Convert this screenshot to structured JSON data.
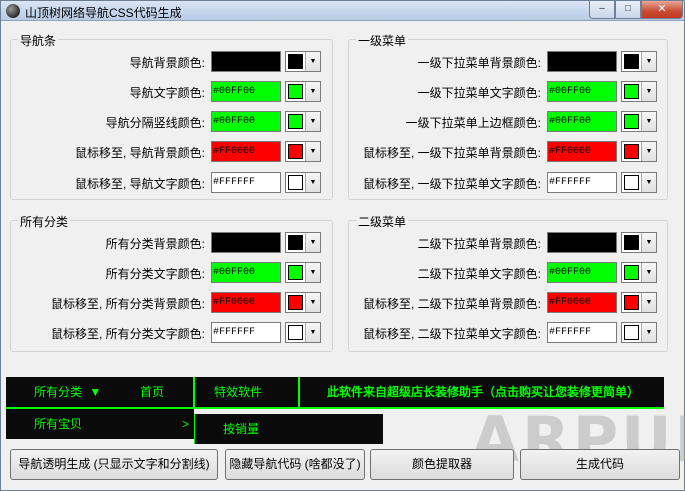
{
  "window": {
    "title": "山顶树网络导航CSS代码生成"
  },
  "groups": {
    "nav": {
      "title": "导航条",
      "rows": [
        {
          "label": "导航背景颜色:",
          "value": "",
          "color": "#000000"
        },
        {
          "label": "导航文字颜色:",
          "value": "#00FF00",
          "color": "#00FF00"
        },
        {
          "label": "导航分隔竖线颜色:",
          "value": "#00FF00",
          "color": "#00FF00"
        },
        {
          "label": "鼠标移至, 导航背景颜色:",
          "value": "#FF0000",
          "color": "#FF0000"
        },
        {
          "label": "鼠标移至, 导航文字颜色:",
          "value": "#FFFFFF",
          "color": "#FFFFFF"
        }
      ]
    },
    "menu1": {
      "title": "一级菜单",
      "rows": [
        {
          "label": "一级下拉菜单背景颜色:",
          "value": "",
          "color": "#000000"
        },
        {
          "label": "一级下拉菜单文字颜色:",
          "value": "#00FF00",
          "color": "#00FF00"
        },
        {
          "label": "一级下拉菜单上边框颜色:",
          "value": "#00FF00",
          "color": "#00FF00"
        },
        {
          "label": "鼠标移至, 一级下拉菜单背景颜色:",
          "value": "#FF0000",
          "color": "#FF0000"
        },
        {
          "label": "鼠标移至, 一级下拉菜单文字颜色:",
          "value": "#FFFFFF",
          "color": "#FFFFFF"
        }
      ]
    },
    "cat": {
      "title": "所有分类",
      "rows": [
        {
          "label": "所有分类背景颜色:",
          "value": "",
          "color": "#000000"
        },
        {
          "label": "所有分类文字颜色:",
          "value": "#00FF00",
          "color": "#00FF00"
        },
        {
          "label": "鼠标移至, 所有分类背景颜色:",
          "value": "#FF0000",
          "color": "#FF0000"
        },
        {
          "label": "鼠标移至, 所有分类文字颜色:",
          "value": "#FFFFFF",
          "color": "#FFFFFF"
        }
      ]
    },
    "menu2": {
      "title": "二级菜单",
      "rows": [
        {
          "label": "二级下拉菜单背景颜色:",
          "value": "",
          "color": "#000000"
        },
        {
          "label": "二级下拉菜单文字颜色:",
          "value": "#00FF00",
          "color": "#00FF00"
        },
        {
          "label": "鼠标移至, 二级下拉菜单背景颜色:",
          "value": "#FF0000",
          "color": "#FF0000"
        },
        {
          "label": "鼠标移至, 二级下拉菜单文字颜色:",
          "value": "#FFFFFF",
          "color": "#FFFFFF"
        }
      ]
    }
  },
  "preview": {
    "all_categories": "所有分类",
    "all_categories_arrow": "▼",
    "home": "首页",
    "special": "特效软件",
    "info": "此软件来自超级店长装修助手（点击购买让您装修更简单）",
    "submenu1": "所有宝贝",
    "submenu1_arrow": ">",
    "submenu2": "按销量"
  },
  "buttons": {
    "transparent": "导航透明生成 (只显示文字和分割线)",
    "hide": "隐藏导航代码 (啥都没了)",
    "picker": "颜色提取器",
    "generate": "生成代码"
  },
  "watermark": "ARPUN"
}
